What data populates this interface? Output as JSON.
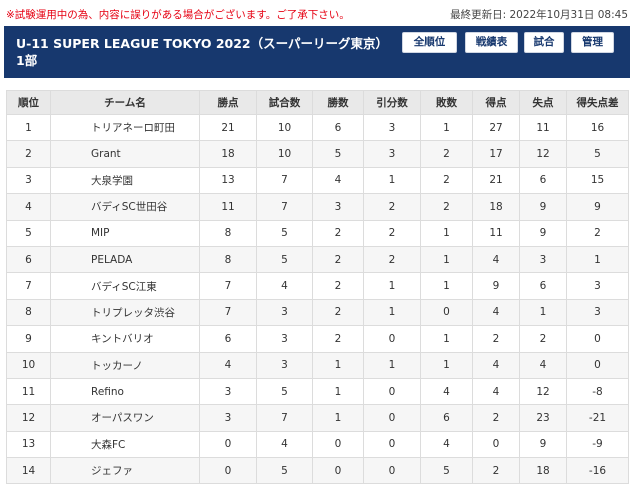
{
  "notice": "※試験運用中の為、内容に誤りがある場合がございます。ご了承下さい。",
  "updated": "最終更新日: 2022年10月31日 08:45",
  "header": {
    "title": "U-11 SUPER LEAGUE TOKYO 2022（スーパーリーグ東京）1部",
    "buttons": {
      "rank": "全順位",
      "cross": "戦績表",
      "match": "試合",
      "admin": "管理"
    }
  },
  "colors": {
    "header_bg": "#17386e",
    "notice": "#e60012"
  },
  "table": {
    "headers": [
      "順位",
      "チーム名",
      "勝点",
      "試合数",
      "勝数",
      "引分数",
      "敗数",
      "得点",
      "失点",
      "得失点差"
    ],
    "rows": [
      [
        "1",
        "トリアネーロ町田",
        "21",
        "10",
        "6",
        "3",
        "1",
        "27",
        "11",
        "16"
      ],
      [
        "2",
        "Grant",
        "18",
        "10",
        "5",
        "3",
        "2",
        "17",
        "12",
        "5"
      ],
      [
        "3",
        "大泉学園",
        "13",
        "7",
        "4",
        "1",
        "2",
        "21",
        "6",
        "15"
      ],
      [
        "4",
        "バディSC世田谷",
        "11",
        "7",
        "3",
        "2",
        "2",
        "18",
        "9",
        "9"
      ],
      [
        "5",
        "MIP",
        "8",
        "5",
        "2",
        "2",
        "1",
        "11",
        "9",
        "2"
      ],
      [
        "6",
        "PELADA",
        "8",
        "5",
        "2",
        "2",
        "1",
        "4",
        "3",
        "1"
      ],
      [
        "7",
        "バディSC江東",
        "7",
        "4",
        "2",
        "1",
        "1",
        "9",
        "6",
        "3"
      ],
      [
        "8",
        "トリプレッタ渋谷",
        "7",
        "3",
        "2",
        "1",
        "0",
        "4",
        "1",
        "3"
      ],
      [
        "9",
        "キントバリオ",
        "6",
        "3",
        "2",
        "0",
        "1",
        "2",
        "2",
        "0"
      ],
      [
        "10",
        "トッカーノ",
        "4",
        "3",
        "1",
        "1",
        "1",
        "4",
        "4",
        "0"
      ],
      [
        "11",
        "Refino",
        "3",
        "5",
        "1",
        "0",
        "4",
        "4",
        "12",
        "-8"
      ],
      [
        "12",
        "オーパスワン",
        "3",
        "7",
        "1",
        "0",
        "6",
        "2",
        "23",
        "-21"
      ],
      [
        "13",
        "大森FC",
        "0",
        "4",
        "0",
        "0",
        "4",
        "0",
        "9",
        "-9"
      ],
      [
        "14",
        "ジェファ",
        "0",
        "5",
        "0",
        "0",
        "5",
        "2",
        "18",
        "-16"
      ]
    ]
  }
}
